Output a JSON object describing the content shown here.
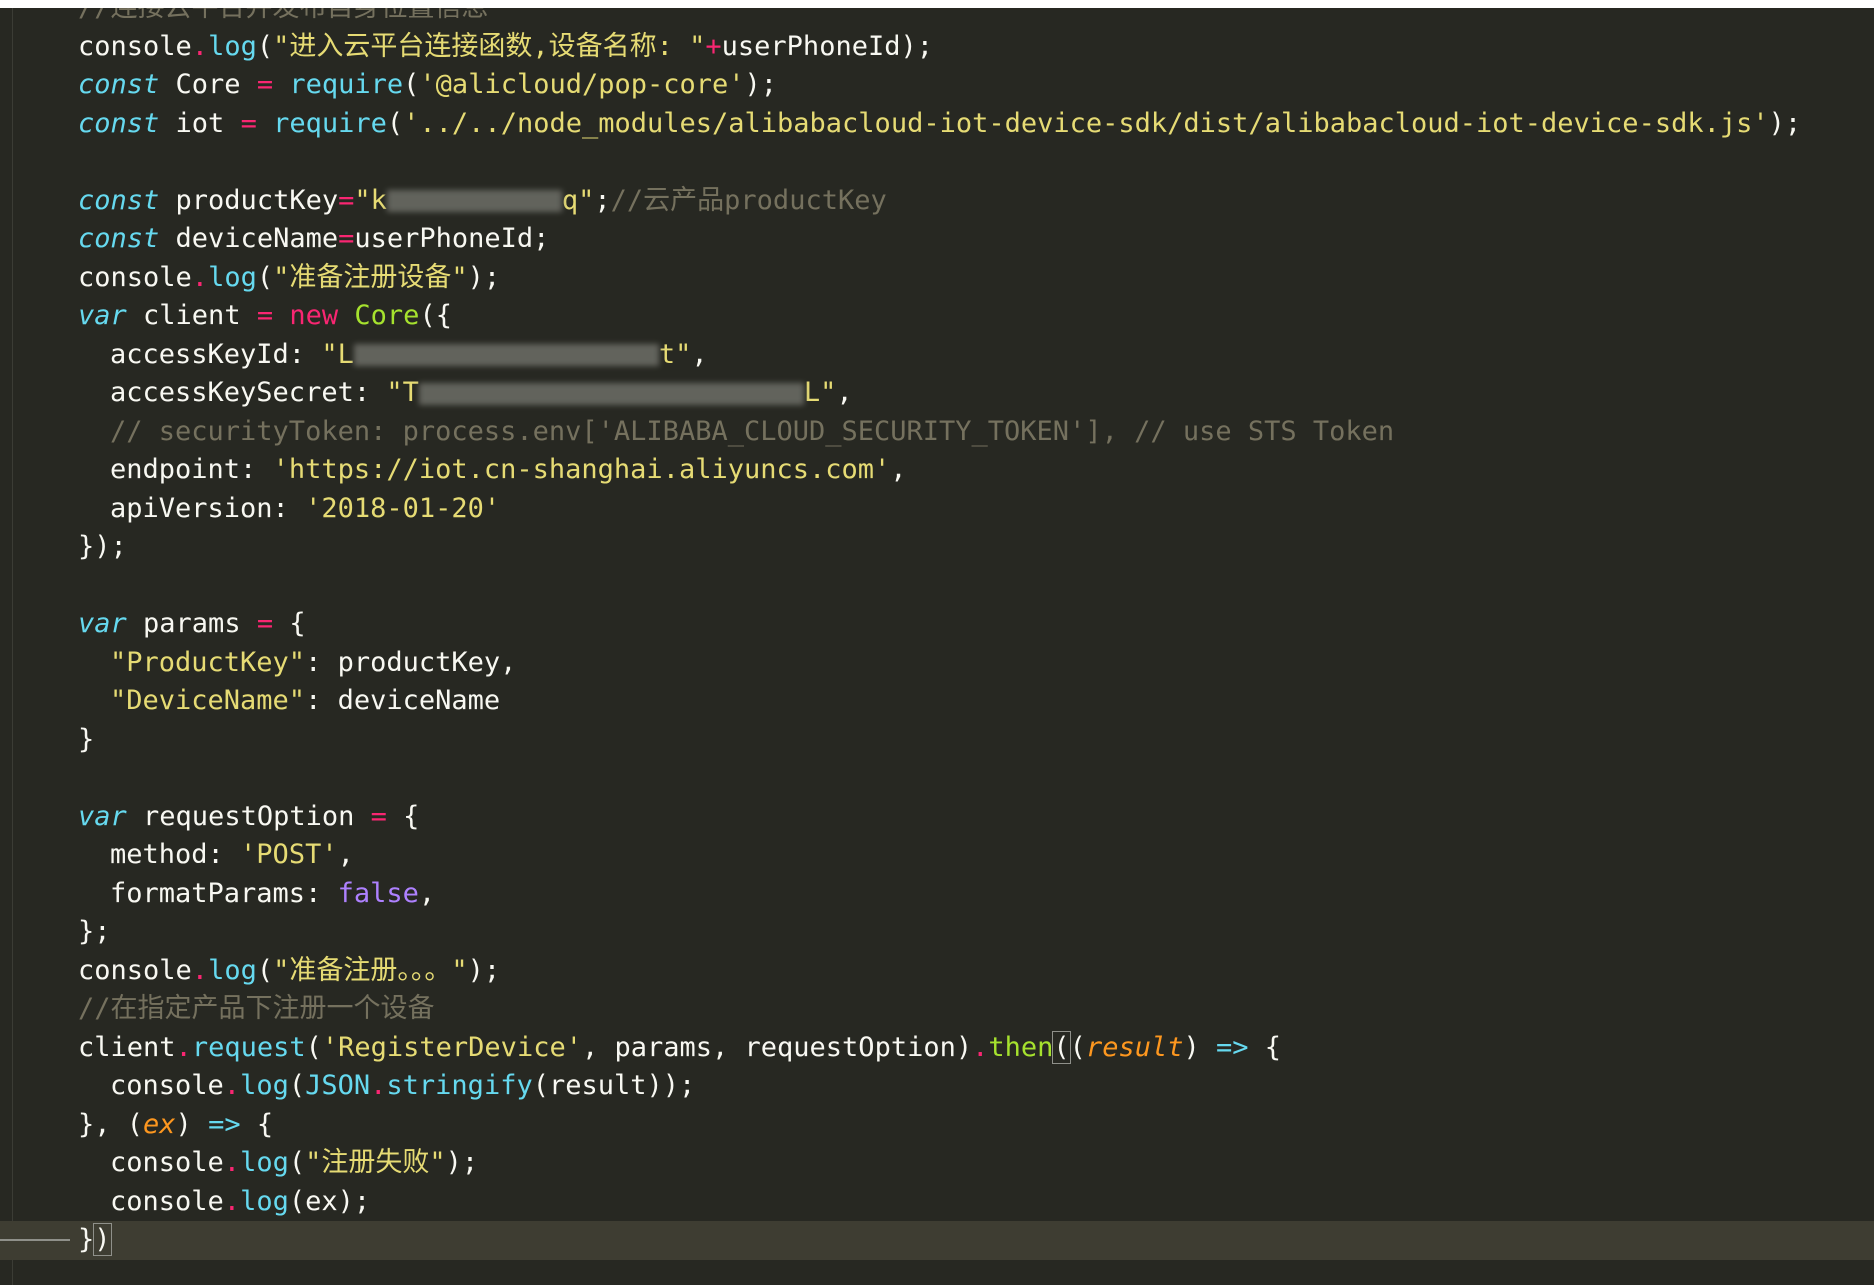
{
  "editor": {
    "lines": [
      {
        "indent": 0,
        "tokens": [
          {
            "t": "comment",
            "v": "//连接云平台并发布自身位置信息"
          }
        ]
      },
      {
        "indent": 0,
        "tokens": [
          {
            "t": "plain",
            "v": "console"
          },
          {
            "t": "op",
            "v": "."
          },
          {
            "t": "fn",
            "v": "log"
          },
          {
            "t": "plain",
            "v": "("
          },
          {
            "t": "str",
            "v": "\"进入云平台连接函数,设备名称: \""
          },
          {
            "t": "op",
            "v": "+"
          },
          {
            "t": "plain",
            "v": "userPhoneId);"
          }
        ]
      },
      {
        "indent": 0,
        "tokens": [
          {
            "t": "kw",
            "v": "const"
          },
          {
            "t": "plain",
            "v": " Core "
          },
          {
            "t": "op",
            "v": "="
          },
          {
            "t": "plain",
            "v": " "
          },
          {
            "t": "fn",
            "v": "require"
          },
          {
            "t": "plain",
            "v": "("
          },
          {
            "t": "str",
            "v": "'@alicloud/pop-core'"
          },
          {
            "t": "plain",
            "v": ");"
          }
        ]
      },
      {
        "indent": 0,
        "tokens": [
          {
            "t": "kw",
            "v": "const"
          },
          {
            "t": "plain",
            "v": " iot "
          },
          {
            "t": "op",
            "v": "="
          },
          {
            "t": "plain",
            "v": " "
          },
          {
            "t": "fn",
            "v": "require"
          },
          {
            "t": "plain",
            "v": "("
          },
          {
            "t": "str",
            "v": "'../../node_modules/alibabacloud-iot-device-sdk/dist/alibabacloud-iot-device-sdk.js'"
          },
          {
            "t": "plain",
            "v": ");"
          }
        ]
      },
      {
        "indent": 0,
        "tokens": []
      },
      {
        "indent": 0,
        "tokens": [
          {
            "t": "kw",
            "v": "const"
          },
          {
            "t": "plain",
            "v": " productKey"
          },
          {
            "t": "op",
            "v": "="
          },
          {
            "t": "str",
            "v": "\"k"
          },
          {
            "t": "redacted",
            "v": "175"
          },
          {
            "t": "str",
            "v": "q\""
          },
          {
            "t": "plain",
            "v": ";"
          },
          {
            "t": "comment",
            "v": "//云产品productKey"
          }
        ]
      },
      {
        "indent": 0,
        "tokens": [
          {
            "t": "kw",
            "v": "const"
          },
          {
            "t": "plain",
            "v": " deviceName"
          },
          {
            "t": "op",
            "v": "="
          },
          {
            "t": "plain",
            "v": "userPhoneId;"
          }
        ]
      },
      {
        "indent": 0,
        "tokens": [
          {
            "t": "plain",
            "v": "console"
          },
          {
            "t": "op",
            "v": "."
          },
          {
            "t": "fn",
            "v": "log"
          },
          {
            "t": "plain",
            "v": "("
          },
          {
            "t": "str",
            "v": "\"准备注册设备\""
          },
          {
            "t": "plain",
            "v": ");"
          }
        ]
      },
      {
        "indent": 0,
        "tokens": [
          {
            "t": "kw",
            "v": "var"
          },
          {
            "t": "plain",
            "v": " client "
          },
          {
            "t": "op",
            "v": "="
          },
          {
            "t": "plain",
            "v": " "
          },
          {
            "t": "op",
            "v": "new"
          },
          {
            "t": "plain",
            "v": " "
          },
          {
            "t": "class",
            "v": "Core"
          },
          {
            "t": "plain",
            "v": "({"
          }
        ]
      },
      {
        "indent": 1,
        "tokens": [
          {
            "t": "plain",
            "v": "accessKeyId: "
          },
          {
            "t": "str",
            "v": "\"L"
          },
          {
            "t": "redacted",
            "v": "305"
          },
          {
            "t": "str",
            "v": "t\""
          },
          {
            "t": "plain",
            "v": ","
          }
        ]
      },
      {
        "indent": 1,
        "tokens": [
          {
            "t": "plain",
            "v": "accessKeySecret: "
          },
          {
            "t": "str",
            "v": "\"T"
          },
          {
            "t": "redacted",
            "v": "385"
          },
          {
            "t": "str",
            "v": "L\""
          },
          {
            "t": "plain",
            "v": ","
          }
        ]
      },
      {
        "indent": 1,
        "tokens": [
          {
            "t": "comment",
            "v": "// securityToken: process.env['ALIBABA_CLOUD_SECURITY_TOKEN'], // use STS Token"
          }
        ]
      },
      {
        "indent": 1,
        "tokens": [
          {
            "t": "plain",
            "v": "endpoint: "
          },
          {
            "t": "str",
            "v": "'https://iot.cn-shanghai.aliyuncs.com'"
          },
          {
            "t": "plain",
            "v": ","
          }
        ]
      },
      {
        "indent": 1,
        "tokens": [
          {
            "t": "plain",
            "v": "apiVersion: "
          },
          {
            "t": "str",
            "v": "'2018-01-20'"
          }
        ]
      },
      {
        "indent": 0,
        "tokens": [
          {
            "t": "plain",
            "v": "});"
          }
        ]
      },
      {
        "indent": 0,
        "tokens": []
      },
      {
        "indent": 0,
        "tokens": [
          {
            "t": "kw",
            "v": "var"
          },
          {
            "t": "plain",
            "v": " params "
          },
          {
            "t": "op",
            "v": "="
          },
          {
            "t": "plain",
            "v": " {"
          }
        ]
      },
      {
        "indent": 1,
        "tokens": [
          {
            "t": "str",
            "v": "\"ProductKey\""
          },
          {
            "t": "plain",
            "v": ": productKey,"
          }
        ]
      },
      {
        "indent": 1,
        "tokens": [
          {
            "t": "str",
            "v": "\"DeviceName\""
          },
          {
            "t": "plain",
            "v": ": deviceName"
          }
        ]
      },
      {
        "indent": 0,
        "tokens": [
          {
            "t": "plain",
            "v": "}"
          }
        ]
      },
      {
        "indent": 0,
        "tokens": []
      },
      {
        "indent": 0,
        "tokens": [
          {
            "t": "kw",
            "v": "var"
          },
          {
            "t": "plain",
            "v": " requestOption "
          },
          {
            "t": "op",
            "v": "="
          },
          {
            "t": "plain",
            "v": " {"
          }
        ]
      },
      {
        "indent": 1,
        "tokens": [
          {
            "t": "plain",
            "v": "method: "
          },
          {
            "t": "str",
            "v": "'POST'"
          },
          {
            "t": "plain",
            "v": ","
          }
        ]
      },
      {
        "indent": 1,
        "tokens": [
          {
            "t": "plain",
            "v": "formatParams: "
          },
          {
            "t": "const",
            "v": "false"
          },
          {
            "t": "plain",
            "v": ","
          }
        ]
      },
      {
        "indent": 0,
        "tokens": [
          {
            "t": "plain",
            "v": "};"
          }
        ]
      },
      {
        "indent": 0,
        "tokens": [
          {
            "t": "plain",
            "v": "console"
          },
          {
            "t": "op",
            "v": "."
          },
          {
            "t": "fn",
            "v": "log"
          },
          {
            "t": "plain",
            "v": "("
          },
          {
            "t": "str",
            "v": "\"准备注册。。。\""
          },
          {
            "t": "plain",
            "v": ");"
          }
        ]
      },
      {
        "indent": 0,
        "tokens": [
          {
            "t": "comment",
            "v": "//在指定产品下注册一个设备"
          }
        ]
      },
      {
        "indent": 0,
        "tokens": [
          {
            "t": "plain",
            "v": "client"
          },
          {
            "t": "op",
            "v": "."
          },
          {
            "t": "fn",
            "v": "request"
          },
          {
            "t": "plain",
            "v": "("
          },
          {
            "t": "str",
            "v": "'RegisterDevice'"
          },
          {
            "t": "plain",
            "v": ", params, requestOption)"
          },
          {
            "t": "op",
            "v": "."
          },
          {
            "t": "class",
            "v": "then"
          },
          {
            "t": "bracket",
            "v": "("
          },
          {
            "t": "plain",
            "v": "("
          },
          {
            "t": "param",
            "v": "result"
          },
          {
            "t": "plain",
            "v": ") "
          },
          {
            "t": "kw",
            "v": "=>"
          },
          {
            "t": "plain",
            "v": " {"
          }
        ]
      },
      {
        "indent": 1,
        "tokens": [
          {
            "t": "plain",
            "v": "console"
          },
          {
            "t": "op",
            "v": "."
          },
          {
            "t": "fn",
            "v": "log"
          },
          {
            "t": "plain",
            "v": "("
          },
          {
            "t": "fn",
            "v": "JSON"
          },
          {
            "t": "op",
            "v": "."
          },
          {
            "t": "fn",
            "v": "stringify"
          },
          {
            "t": "plain",
            "v": "(result));"
          }
        ]
      },
      {
        "indent": 0,
        "tokens": [
          {
            "t": "plain",
            "v": "}, ("
          },
          {
            "t": "param",
            "v": "ex"
          },
          {
            "t": "plain",
            "v": ") "
          },
          {
            "t": "kw",
            "v": "=>"
          },
          {
            "t": "plain",
            "v": " {"
          }
        ]
      },
      {
        "indent": 1,
        "tokens": [
          {
            "t": "plain",
            "v": "console"
          },
          {
            "t": "op",
            "v": "."
          },
          {
            "t": "fn",
            "v": "log"
          },
          {
            "t": "plain",
            "v": "("
          },
          {
            "t": "str",
            "v": "\"注册失败\""
          },
          {
            "t": "plain",
            "v": ");"
          }
        ]
      },
      {
        "indent": 1,
        "tokens": [
          {
            "t": "plain",
            "v": "console"
          },
          {
            "t": "op",
            "v": "."
          },
          {
            "t": "fn",
            "v": "log"
          },
          {
            "t": "plain",
            "v": "(ex);"
          }
        ]
      },
      {
        "indent": 0,
        "current": true,
        "tokens": [
          {
            "t": "plain",
            "v": "}"
          },
          {
            "t": "bracket",
            "v": ")"
          }
        ]
      }
    ]
  }
}
